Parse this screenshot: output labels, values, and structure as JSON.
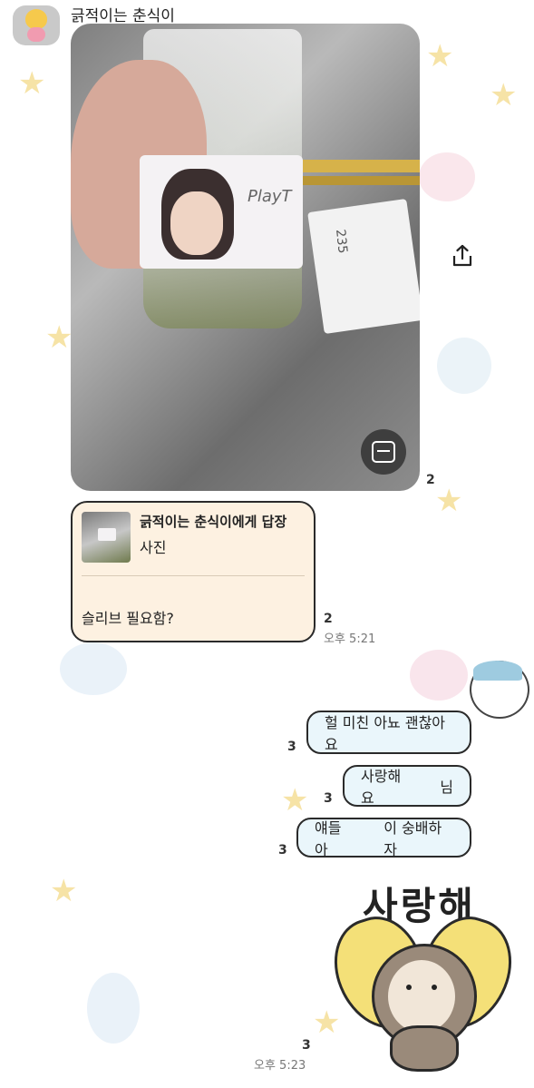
{
  "header": {
    "sender_name": "긁적이는 춘식이"
  },
  "photo_message": {
    "sleeve_text": "PlayT",
    "receipt_number": "235",
    "read_count": "2"
  },
  "reply_message": {
    "reply_title": "긁적이는 춘식이에게 답장",
    "reply_type": "사진",
    "text": "슬리브 필요함?",
    "read_count": "2",
    "time": "오후 5:21"
  },
  "outgoing_messages": [
    {
      "text": "헐 미친 아뇨 괜찮아요",
      "read_count": "3"
    },
    {
      "text_before": "사랑해요",
      "text_after": "님",
      "read_count": "3"
    },
    {
      "text_before": "얘들아",
      "text_after": "이 숭배하자",
      "read_count": "3"
    }
  ],
  "sticker_message": {
    "sticker_text": "사랑해",
    "read_count": "3",
    "time": "오후 5:23"
  },
  "icons": {
    "share": "share-icon",
    "scan": "text-scan-icon"
  },
  "colors": {
    "outgoing_bubble": "#eaf6fb",
    "reply_bubble": "#fdf1e1",
    "bubble_border": "#2a2a2a"
  }
}
